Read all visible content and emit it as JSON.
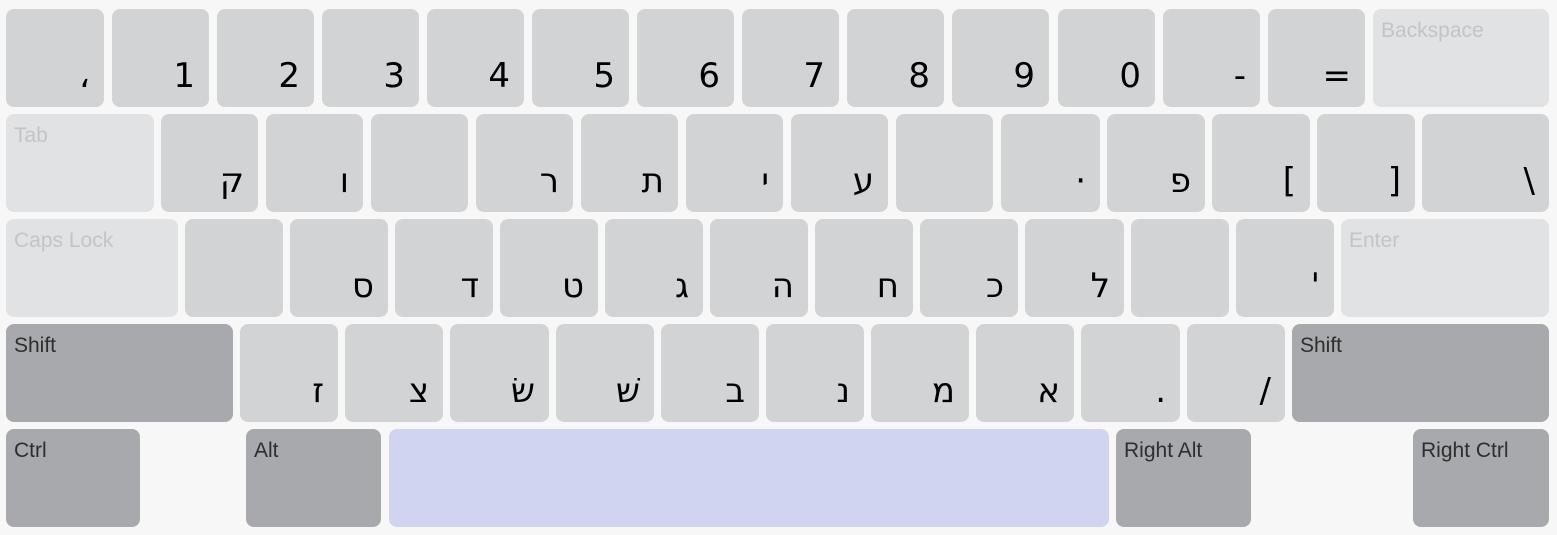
{
  "keyboard": {
    "colors": {
      "key": "#d2d3d5",
      "function_key": "#e1e2e4",
      "modifier_key": "#a8a9ac",
      "space_key": "#d1d4f1",
      "background": "#f7f7f7"
    },
    "rows": [
      [
        "،",
        "1",
        "2",
        "3",
        "4",
        "5",
        "6",
        "7",
        "8",
        "9",
        "0",
        "-",
        "=",
        "Backspace"
      ],
      [
        "Tab",
        "ק",
        "ו",
        "",
        "ר",
        "ת",
        "י",
        "ע",
        "",
        "·",
        "פ",
        "[",
        "]",
        "\\"
      ],
      [
        "Caps Lock",
        "",
        "ס",
        "ד",
        "ט",
        "ג",
        "ה",
        "ח",
        "כ",
        "ל",
        "",
        "'",
        "Enter"
      ],
      [
        "Shift",
        "ז",
        "צ",
        "שׂ",
        "שׁ",
        "ב",
        "נ",
        "מ",
        "א",
        ".",
        "/",
        "Shift"
      ],
      [
        "Ctrl",
        "Alt",
        "",
        "Right Alt",
        "Right Ctrl"
      ]
    ]
  }
}
